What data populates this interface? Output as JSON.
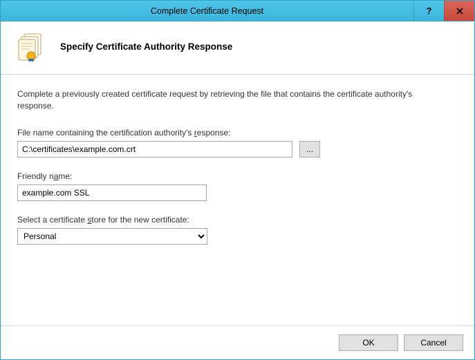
{
  "window": {
    "title": "Complete Certificate Request",
    "help_tooltip": "?",
    "close_label": "Close"
  },
  "header": {
    "title": "Specify Certificate Authority Response"
  },
  "intro": "Complete a previously created certificate request by retrieving the file that contains the certificate authority's response.",
  "fields": {
    "file": {
      "label_pre": "File name containing the certification authority's ",
      "label_u": "r",
      "label_post": "esponse:",
      "value": "C:\\certificates\\example.com.crt",
      "browse": "..."
    },
    "friendly": {
      "label_pre": "Friendly n",
      "label_u": "a",
      "label_post": "me:",
      "value": "example.com SSL"
    },
    "store": {
      "label_pre": "Select a certificate ",
      "label_u": "s",
      "label_post": "tore for the new certificate:",
      "selected": "Personal"
    }
  },
  "footer": {
    "ok": "OK",
    "cancel": "Cancel"
  }
}
